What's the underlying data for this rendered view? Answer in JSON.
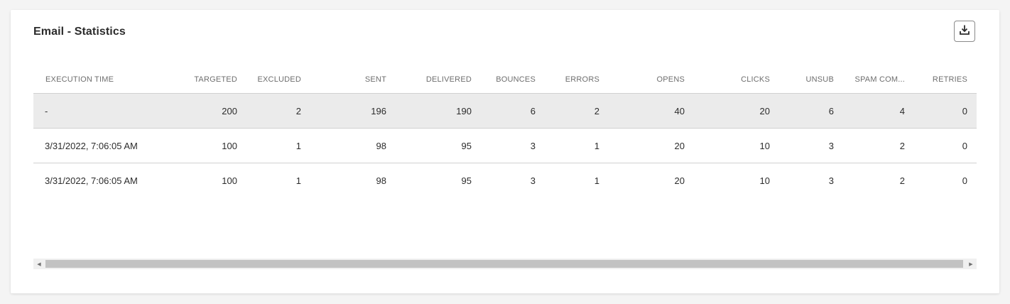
{
  "title": "Email - Statistics",
  "download_icon": "download-icon",
  "columns": [
    "EXECUTION TIME",
    "TARGETED",
    "EXCLUDED",
    "SENT",
    "DELIVERED",
    "BOUNCES",
    "ERRORS",
    "OPENS",
    "CLICKS",
    "UNSUB",
    "SPAM COM...",
    "RETRIES"
  ],
  "rows": [
    [
      "-",
      "200",
      "2",
      "196",
      "190",
      "6",
      "2",
      "40",
      "20",
      "6",
      "4",
      "0"
    ],
    [
      "3/31/2022, 7:06:05 AM",
      "100",
      "1",
      "98",
      "95",
      "3",
      "1",
      "20",
      "10",
      "3",
      "2",
      "0"
    ],
    [
      "3/31/2022, 7:06:05 AM",
      "100",
      "1",
      "98",
      "95",
      "3",
      "1",
      "20",
      "10",
      "3",
      "2",
      "0"
    ]
  ],
  "scroll": {
    "left_arrow": "◀",
    "right_arrow": "▶",
    "position": 0.0
  }
}
